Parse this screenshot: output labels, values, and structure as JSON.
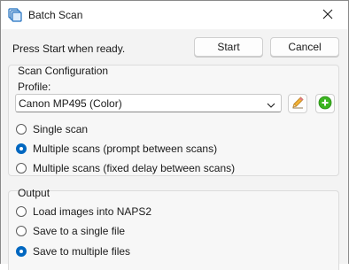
{
  "window": {
    "title": "Batch Scan",
    "close_glyph": "✕"
  },
  "status": {
    "text": "Press Start when ready."
  },
  "buttons": {
    "start": "Start",
    "cancel": "Cancel"
  },
  "scan_config": {
    "legend": "Scan Configuration",
    "profile_label": "Profile:",
    "profile_value": "Canon MP495 (Color)",
    "edit_icon": "pencil-icon",
    "add_icon": "plus-circle-icon",
    "options": [
      {
        "label": "Single scan",
        "checked": false
      },
      {
        "label": "Multiple scans (prompt between scans)",
        "checked": true
      },
      {
        "label": "Multiple scans (fixed delay between scans)",
        "checked": false
      }
    ]
  },
  "output": {
    "legend": "Output",
    "options": [
      {
        "label": "Load images into NAPS2",
        "checked": false
      },
      {
        "label": "Save to a single file",
        "checked": false
      },
      {
        "label": "Save to multiple files",
        "checked": true
      }
    ]
  },
  "colors": {
    "accent": "#0067c0",
    "add_green": "#3cb521"
  }
}
